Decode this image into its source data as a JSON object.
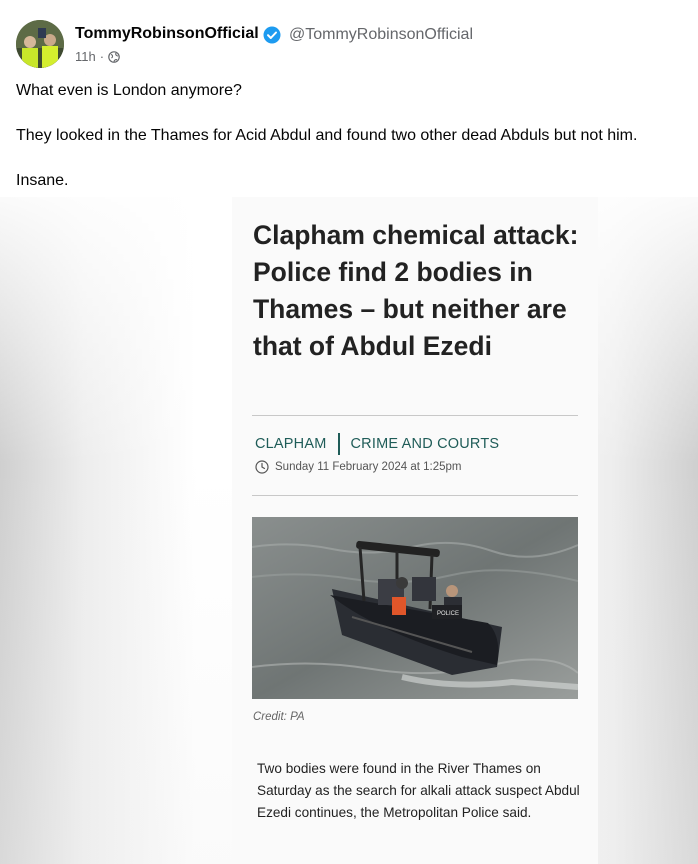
{
  "post": {
    "author_name": "TommyRobinsonOfficial",
    "handle": "@TommyRobinsonOfficial",
    "time": "11h",
    "meta_separator": "·",
    "icons": {
      "verified": "verified-badge-icon",
      "audience": "globe-icon",
      "avatar": "avatar"
    },
    "lines": [
      "What even is London anymore?",
      "They looked in the Thames for Acid Abdul and found two other dead Abduls but not him.",
      "Insane."
    ]
  },
  "article": {
    "headline": "Clapham chemical attack: Police find 2 bodies in Thames – but neither are that of Abdul Ezedi",
    "tags": [
      "CLAPHAM",
      "CRIME AND COURTS"
    ],
    "date": "Sunday 11 February 2024 at 1:25pm",
    "photo_label": "POLICE",
    "credit": "Credit: PA",
    "body": "Two bodies were found in the River Thames on Saturday as the search for alkali attack suspect Abdul Ezedi continues, the Metropolitan Police said."
  },
  "colors": {
    "accent": "#1f5c58",
    "verified": "#1d9bf0",
    "muted": "#65676b"
  }
}
